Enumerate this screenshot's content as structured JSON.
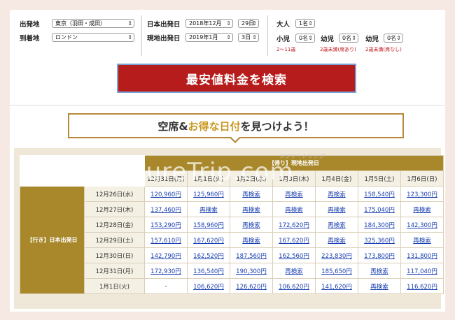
{
  "form": {
    "departure_label": "出発地",
    "departure_value": "東京（羽田・成田）",
    "arrival_label": "到着地",
    "arrival_value": "ロンドン",
    "jp_depart_label": "日本出発日",
    "jp_depart_month": "2018年12月",
    "jp_depart_day": "29日",
    "local_depart_label": "現地出発日",
    "local_depart_month": "2019年1月",
    "local_depart_day": "3日",
    "adult_label": "大人",
    "adult_value": "1名",
    "child_label": "小児",
    "child_value": "0名",
    "child_hint": "2〜11歳",
    "infant_seat_label": "幼児",
    "infant_seat_value": "0名",
    "infant_seat_hint": "2歳未満(席あり)",
    "infant_noseat_label": "幼児",
    "infant_noseat_value": "0名",
    "infant_noseat_hint": "2歳未満(席なし)"
  },
  "search_button": "最安値料金を検索",
  "banner": {
    "part1": "空席&",
    "accent": "お得な日付",
    "part2": "を見つけよう！"
  },
  "watermark": "measureTrip.com",
  "watermark_sub": "メジャートリップ",
  "table": {
    "return_header": "【帰り】現地出発日",
    "outbound_header": "【行き】日本出発日",
    "return_dates": [
      "12月31日(月)",
      "1月1日(火)",
      "1月2日(水)",
      "1月3日(木)",
      "1月4日(金)",
      "1月5日(土)",
      "1月6日(日)"
    ],
    "rows": [
      {
        "date": "12月26日(水)",
        "cells": [
          "120,960円",
          "125,960円",
          "再検索",
          "再検索",
          "再検索",
          "158,540円",
          "123,300円"
        ]
      },
      {
        "date": "12月27日(木)",
        "cells": [
          "137,460円",
          "再検索",
          "再検索",
          "再検索",
          "再検索",
          "175,040円",
          "再検索"
        ]
      },
      {
        "date": "12月28日(金)",
        "cells": [
          "153,290円",
          "158,960円",
          "再検索",
          "172,620円",
          "再検索",
          "184,300円",
          "142,300円"
        ]
      },
      {
        "date": "12月29日(土)",
        "cells": [
          "157,610円",
          "167,620円",
          "再検索",
          "167,620円",
          "再検索",
          "325,360円",
          "再検索"
        ]
      },
      {
        "date": "12月30日(日)",
        "cells": [
          "142,790円",
          "162,520円",
          "187,560円",
          "162,560円",
          "223,830円",
          "173,800円",
          "131,800円"
        ]
      },
      {
        "date": "12月31日(月)",
        "cells": [
          "172,930円",
          "136,540円",
          "190,300円",
          "再検索",
          "185,650円",
          "再検索",
          "117,040円"
        ]
      },
      {
        "date": "1月1日(火)",
        "cells": [
          "-",
          "106,620円",
          "126,620円",
          "106,620円",
          "141,620円",
          "再検索",
          "116,620円"
        ]
      }
    ]
  }
}
